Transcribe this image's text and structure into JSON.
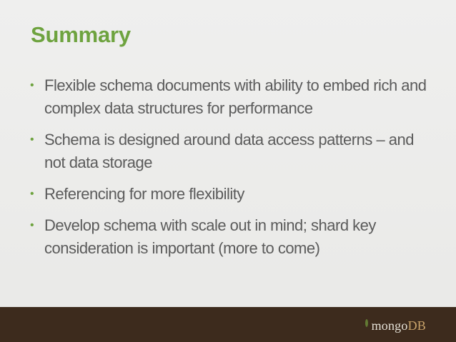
{
  "slide": {
    "title": "Summary",
    "bullets": [
      "Flexible schema documents with ability to embed rich and complex data structures for performance",
      "Schema is designed around data access patterns – and not data storage",
      "Referencing for more flexibility",
      "Develop schema with scale out in mind; shard key consideration is important (more to come)"
    ],
    "bullet_symbol": "•"
  },
  "footer": {
    "logo_text_main": "mongo",
    "logo_text_accent": "DB"
  },
  "colors": {
    "title": "#6ea33f",
    "body_text": "#5b5b5b",
    "footer_bg": "#3d2b1d",
    "logo_text": "#e4e0d6",
    "logo_accent": "#c9a36a"
  }
}
